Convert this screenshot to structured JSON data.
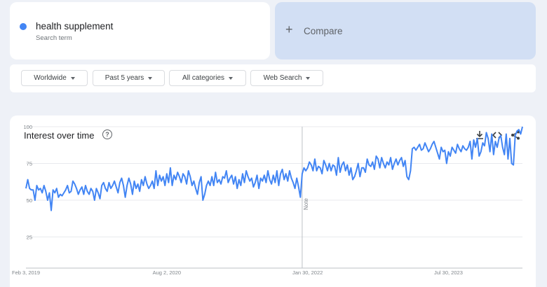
{
  "search_term": {
    "name": "health supplement",
    "label": "Search term",
    "color": "#4285f4"
  },
  "compare": {
    "label": "Compare",
    "plus": "+",
    "background": "#d2dff4"
  },
  "filters": [
    {
      "label": "Worldwide"
    },
    {
      "label": "Past 5 years"
    },
    {
      "label": "All categories"
    },
    {
      "label": "Web Search"
    }
  ],
  "chart": {
    "title": "Interest over time",
    "help_glyph": "?",
    "tools": [
      "download-icon",
      "embed-icon",
      "share-icon"
    ],
    "note_label": "Note"
  },
  "chart_data": {
    "type": "line",
    "title": "Interest over time",
    "ylim": [
      0,
      100
    ],
    "y_ticks": [
      100,
      75,
      50,
      25
    ],
    "x_ticks": [
      {
        "label": "Feb 3, 2019",
        "week": 0
      },
      {
        "label": "Aug 2, 2020",
        "week": 78
      },
      {
        "label": "Jan 30, 2022",
        "week": 156
      },
      {
        "label": "Jul 30, 2023",
        "week": 234
      }
    ],
    "grid": true,
    "note_week": 153,
    "series": [
      {
        "color": "#4285f4",
        "values": [
          58,
          64,
          58,
          57,
          57,
          50,
          60,
          57,
          58,
          55,
          60,
          56,
          50,
          55,
          43,
          57,
          55,
          58,
          52,
          54,
          53,
          55,
          57,
          60,
          55,
          56,
          63,
          61,
          58,
          54,
          57,
          59,
          54,
          60,
          56,
          54,
          58,
          56,
          50,
          58,
          55,
          51,
          60,
          62,
          58,
          56,
          62,
          58,
          60,
          63,
          59,
          55,
          62,
          65,
          60,
          52,
          60,
          65,
          61,
          54,
          63,
          58,
          61,
          56,
          64,
          60,
          66,
          61,
          58,
          60,
          63,
          58,
          70,
          60,
          67,
          63,
          66,
          60,
          68,
          62,
          72,
          60,
          67,
          64,
          69,
          66,
          62,
          68,
          66,
          61,
          70,
          66,
          60,
          63,
          58,
          54,
          62,
          66,
          50,
          54,
          60,
          63,
          60,
          66,
          60,
          69,
          62,
          64,
          61,
          66,
          65,
          70,
          62,
          65,
          67,
          61,
          66,
          58,
          64,
          60,
          68,
          62,
          70,
          66,
          63,
          65,
          59,
          62,
          67,
          58,
          65,
          63,
          67,
          62,
          70,
          64,
          61,
          67,
          62,
          70,
          60,
          68,
          71,
          64,
          68,
          63,
          70,
          65,
          62,
          58,
          65,
          59,
          52,
          68,
          72,
          70,
          72,
          76,
          74,
          70,
          78,
          70,
          73,
          72,
          68,
          77,
          74,
          70,
          75,
          70,
          74,
          73,
          67,
          79,
          69,
          74,
          76,
          70,
          74,
          67,
          72,
          64,
          66,
          70,
          75,
          66,
          72,
          72,
          69,
          78,
          74,
          73,
          76,
          71,
          80,
          78,
          72,
          79,
          75,
          72,
          76,
          74,
          79,
          71,
          75,
          78,
          74,
          77,
          79,
          73,
          77,
          66,
          64,
          70,
          85,
          86,
          84,
          86,
          88,
          84,
          85,
          89,
          86,
          83,
          85,
          88,
          90,
          86,
          82,
          78,
          86,
          83,
          84,
          75,
          83,
          80,
          86,
          84,
          82,
          88,
          85,
          83,
          87,
          85,
          84,
          86,
          90,
          78,
          91,
          86,
          92,
          80,
          83,
          89,
          87,
          96,
          92,
          83,
          95,
          81,
          90,
          86,
          92,
          94,
          86,
          81,
          95,
          78,
          92,
          75,
          74,
          94,
          97,
          98,
          95,
          100
        ]
      }
    ]
  }
}
